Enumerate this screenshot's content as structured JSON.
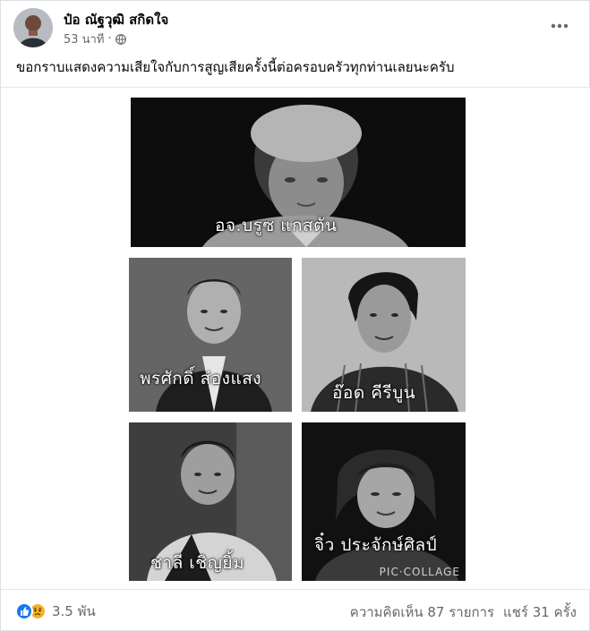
{
  "post": {
    "author": "ป๋อ ณัฐวุฒิ สกิดใจ",
    "time": "53 นาที",
    "separator": "·",
    "audience_icon": "globe-icon",
    "more_icon": "more-options-icon",
    "text": "ขอกราบแสดงความเสียใจกับการสูญเสียครั้งนี้ต่อครอบครัวทุกท่านเลยนะครับ"
  },
  "collage": {
    "tiles": [
      {
        "caption": "อจ.บรูซ แกสตัน"
      },
      {
        "caption": "พรศักดิ์ ส่องแสง"
      },
      {
        "caption": "อ๊อด คีรีบูน"
      },
      {
        "caption": "ชาลี เชิญยิ้ม"
      },
      {
        "caption": "จิ๋ว ประจักษ์ศิลป์"
      }
    ],
    "watermark": "PIC·COLLAGE"
  },
  "footer": {
    "reaction_icons": [
      "like-icon",
      "sad-icon"
    ],
    "reaction_count": "3.5 พัน",
    "comments": "ความคิดเห็น 87 รายการ",
    "shares": "แชร์ 31 ครั้ง"
  },
  "colors": {
    "like_blue": "#1877f2",
    "sad_yellow": "#f7b125",
    "secondary_text": "#65676b"
  }
}
